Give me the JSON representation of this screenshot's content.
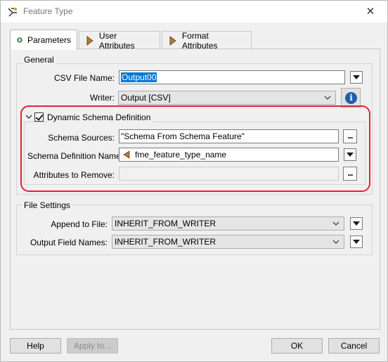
{
  "window": {
    "title": "Feature Type",
    "close_glyph": "✕"
  },
  "tabs": [
    {
      "label": "Parameters",
      "icon": "gear-icon",
      "active": true
    },
    {
      "label": "User Attributes",
      "icon": "attribute-arrow-icon",
      "active": false
    },
    {
      "label": "Format Attributes",
      "icon": "attribute-arrow-icon",
      "active": false
    }
  ],
  "general": {
    "group_label": "General",
    "csv_file_name_label": "CSV File Name:",
    "csv_file_name_value": "Output00",
    "writer_label": "Writer:",
    "writer_value": "Output [CSV]",
    "info_glyph": "i"
  },
  "dynamic_schema": {
    "checkbox_label": "Dynamic Schema Definition",
    "checked": true,
    "schema_sources_label": "Schema Sources:",
    "schema_sources_value": "\"Schema From Schema Feature\"",
    "schema_definition_name_label": "Schema Definition Name:",
    "schema_definition_name_value": "fme_feature_type_name",
    "attributes_to_remove_label": "Attributes to Remove:",
    "attributes_to_remove_value": "",
    "ellipsis": "..."
  },
  "file_settings": {
    "group_label": "File Settings",
    "append_to_file_label": "Append to File:",
    "append_to_file_value": "INHERIT_FROM_WRITER",
    "output_field_names_label": "Output Field Names:",
    "output_field_names_value": "INHERIT_FROM_WRITER"
  },
  "footer": {
    "help_label": "Help",
    "apply_label": "Apply to...",
    "ok_label": "OK",
    "cancel_label": "Cancel"
  },
  "colors": {
    "highlight": "#e0233a",
    "selection": "#0078d7",
    "info": "#1f5fa8",
    "attribute_icon": "#b5793a"
  }
}
